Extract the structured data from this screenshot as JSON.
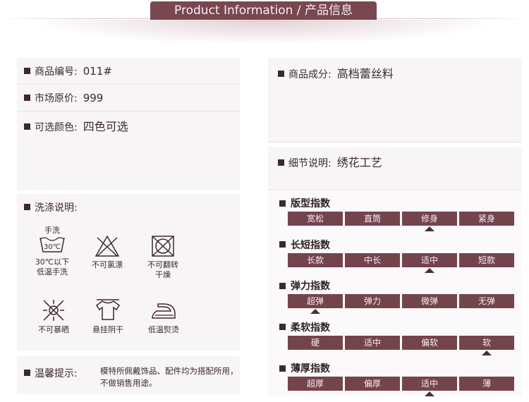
{
  "header": {
    "title": "Product Information / 产品信息"
  },
  "left": {
    "product_code": {
      "label": "商品编号:",
      "value": "011#"
    },
    "market_price": {
      "label": "市场原价:",
      "value": "999"
    },
    "colors": {
      "label": "可选颜色:",
      "value": "四色可选"
    },
    "washing": {
      "label": "洗涤说明:",
      "items": [
        {
          "icon": "hand-wash-icon",
          "caption": "30℃以下\n低温手洗",
          "top_text": "手洗",
          "temp": "30℃"
        },
        {
          "icon": "no-bleach-icon",
          "caption": "不可氯漂"
        },
        {
          "icon": "no-tumble-dry-icon",
          "caption": "不可翻转\n干燥"
        },
        {
          "icon": "no-sun-dry-icon",
          "caption": "不可暴晒"
        },
        {
          "icon": "hang-dry-shade-icon",
          "caption": "悬挂阴干"
        },
        {
          "icon": "low-temp-iron-icon",
          "caption": "低温熨烫"
        }
      ]
    },
    "tips": {
      "label": "温馨提示:",
      "text_line1": "模特所佩戴饰品、配件均为搭配所用，",
      "text_line2": "不做销售用途。"
    }
  },
  "right": {
    "composition": {
      "label": "商品成分:",
      "value": "高档蕾丝料"
    },
    "details": {
      "label": "细节说明:",
      "value": "绣花工艺"
    },
    "indices": [
      {
        "title": "版型指数",
        "options": [
          "宽松",
          "直筒",
          "修身",
          "紧身"
        ],
        "selected": 2
      },
      {
        "title": "长短指数",
        "options": [
          "长款",
          "中长",
          "适中",
          "短款"
        ],
        "selected": 2
      },
      {
        "title": "弹力指数",
        "options": [
          "超弹",
          "弹力",
          "微弹",
          "无弹"
        ],
        "selected": 0
      },
      {
        "title": "柔软指数",
        "options": [
          "硬",
          "适中",
          "偏软",
          "软"
        ],
        "selected": 3
      },
      {
        "title": "薄厚指数",
        "options": [
          "超厚",
          "偏厚",
          "适中",
          "薄"
        ],
        "selected": 2
      }
    ]
  }
}
